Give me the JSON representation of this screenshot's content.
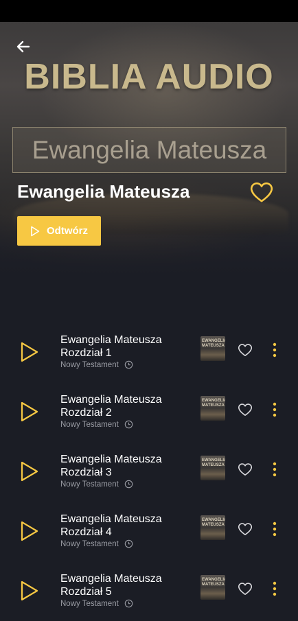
{
  "header": {
    "brand": "BIBLIA AUDIO",
    "cover_text": "Ewangelia Mateusza",
    "album_title": "Ewangelia Mateusza",
    "play_label": "Odtwórz"
  },
  "colors": {
    "accent": "#f7c843",
    "background": "#1b1d25",
    "brand": "#c9b98d"
  },
  "icons": {
    "back": "arrow-left-icon",
    "favorite": "heart-icon",
    "play": "play-icon",
    "duration": "clock-icon",
    "more": "more-vertical-icon"
  },
  "tracks": [
    {
      "title": "Ewangelia Mateusza Rozdział 1",
      "subtitle": "Nowy Testament",
      "thumb_text": "EWANGELIA MATEUSZA"
    },
    {
      "title": "Ewangelia Mateusza Rozdział 2",
      "subtitle": "Nowy Testament",
      "thumb_text": "EWANGELIA MATEUSZA"
    },
    {
      "title": "Ewangelia Mateusza Rozdział 3",
      "subtitle": "Nowy Testament",
      "thumb_text": "EWANGELIA MATEUSZA"
    },
    {
      "title": "Ewangelia Mateusza Rozdział 4",
      "subtitle": "Nowy Testament",
      "thumb_text": "EWANGELIA MATEUSZA"
    },
    {
      "title": "Ewangelia Mateusza Rozdział 5",
      "subtitle": "Nowy Testament",
      "thumb_text": "EWANGELIA MATEUSZA"
    }
  ]
}
